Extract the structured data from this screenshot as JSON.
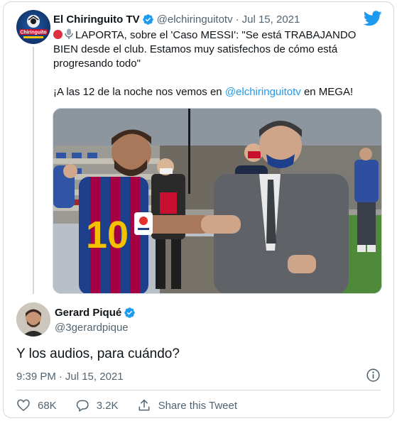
{
  "quoted_tweet": {
    "author_name": "El Chiringuito TV",
    "handle": "@elchiringuitotv",
    "separator": "·",
    "date": "Jul 15, 2021",
    "avatar_text": "Chiringuito",
    "text_line1": "LAPORTA, sobre el 'Caso MESSI': \"Se está TRABAJANDO BIEN desde el club. Estamos muy satisfechos de cómo está progresando todo\"",
    "text_line2_prefix": "¡A las 12 de la noche nos vemos en ",
    "text_line2_mention": "@elchiringuitotv",
    "text_line2_suffix": " en MEGA!",
    "photo_icons": [
      "laliga-badge"
    ]
  },
  "reply_tweet": {
    "author_name": "Gerard Piqué",
    "handle": "@3gerardpique",
    "text": "Y los audios, para cuándo?",
    "time": "9:39 PM",
    "separator": "·",
    "date": "Jul 15, 2021"
  },
  "actions": {
    "like_count": "68K",
    "reply_count": "3.2K",
    "share_label": "Share this Tweet"
  },
  "icons": {
    "logo": "twitter-bird-icon",
    "verified": "verified-badge-icon",
    "info": "info-icon",
    "like": "heart-icon",
    "reply": "reply-bubble-icon",
    "share": "share-icon"
  },
  "colors": {
    "accent": "#1d9bf0",
    "text": "#0f1419",
    "secondary": "#536471",
    "border": "#cfd9de"
  }
}
